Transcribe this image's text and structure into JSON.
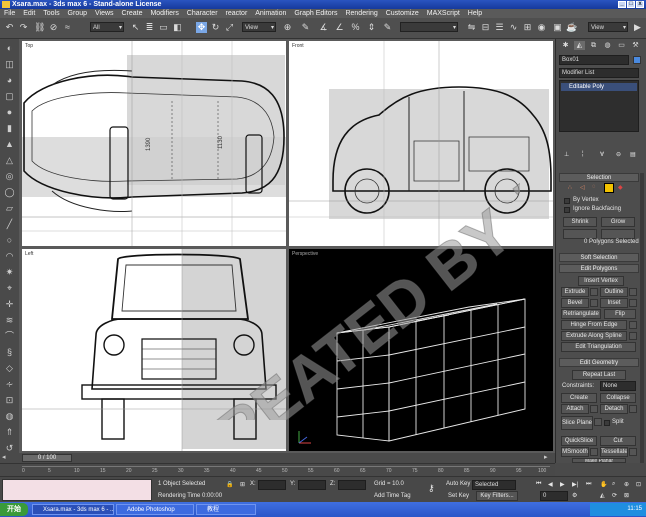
{
  "window": {
    "title": "Xsara.max - 3ds max 6 - Stand-alone License",
    "min": "_",
    "max": "□",
    "close": "x"
  },
  "menu": [
    "File",
    "Edit",
    "Tools",
    "Group",
    "Views",
    "Create",
    "Modifiers",
    "Character",
    "reactor",
    "Animation",
    "Graph Editors",
    "Rendering",
    "Customize",
    "MAXScript",
    "Help"
  ],
  "toolbar": {
    "selection_filter": "All",
    "coord_system": "View",
    "named_selection": "",
    "view_dropdown": "View"
  },
  "viewports": {
    "top": "Top",
    "front": "Front",
    "left": "Left",
    "perspective": "Perspective"
  },
  "top_dims": {
    "a": "1390",
    "b": "1130"
  },
  "command_panel": {
    "object_name": "Box01",
    "modifier_list": "Modifier List",
    "stack_item": "Editable Poly",
    "selection": {
      "title": "Selection",
      "by_vertex": "By Vertex",
      "ignore_backfacing": "Ignore Backfacing",
      "shrink": "Shrink",
      "grow": "Grow",
      "status": "0 Polygons Selected"
    },
    "soft_selection": "Soft Selection",
    "edit_polygons": {
      "title": "Edit Polygons",
      "insert_vertex": "Insert Vertex",
      "extrude": "Extrude",
      "outline": "Outline",
      "bevel": "Bevel",
      "inset": "Inset",
      "retriangulate": "Retriangulate",
      "flip": "Flip",
      "hinge": "Hinge From Edge",
      "extrude_spline": "Extrude Along Spline",
      "edit_triangulation": "Edit Triangulation"
    },
    "edit_geometry": {
      "title": "Edit Geometry",
      "repeat_last": "Repeat Last",
      "constraints_label": "Constraints:",
      "constraints_value": "None",
      "create": "Create",
      "collapse": "Collapse",
      "attach": "Attach",
      "detach": "Detach",
      "slice_plane": "Slice Plane",
      "split": "Split",
      "quickslice": "QuickSlice",
      "cut": "Cut",
      "msmooth": "MSmooth",
      "tessellate": "Tessellate",
      "make_planar": "Make Planar"
    }
  },
  "timeline": {
    "frame": "0 / 100",
    "ticks": [
      "0",
      "5",
      "10",
      "15",
      "20",
      "25",
      "30",
      "35",
      "40",
      "45",
      "50",
      "55",
      "60",
      "65",
      "70",
      "75",
      "80",
      "85",
      "90",
      "95",
      "100"
    ]
  },
  "status": {
    "selected": "1 Object Selected",
    "render_time": "Rendering Time  0:00:00",
    "x_label": "X:",
    "y_label": "Y:",
    "z_label": "Z:",
    "grid": "Grid = 10.0",
    "add_time_tag": "Add Time Tag",
    "auto_key": "Auto Key",
    "auto_key_mode": "Selected",
    "set_key": "Set Key",
    "key_filters": "Key Filters...",
    "frame_field": "0"
  },
  "taskbar": {
    "start": "开始",
    "tasks": [
      "Xsara.max - 3ds max 6 - ...",
      "Adobe Photoshop",
      "教程"
    ],
    "clock": "11:15"
  },
  "watermark": "CREATED BY JINSHI",
  "colors": {
    "title_blue": "#1e47b0",
    "active_yellow": "#f2c200",
    "viewport_white": "#ffffff",
    "viewport_black": "#000000"
  }
}
